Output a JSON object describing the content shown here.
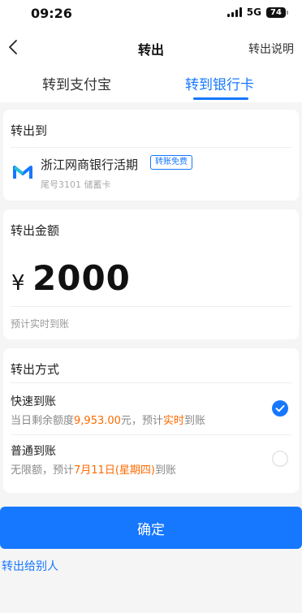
{
  "status": {
    "time": "09:26",
    "network": "5G",
    "battery": "74"
  },
  "nav": {
    "title": "转出",
    "help": "转出说明"
  },
  "tabs": [
    {
      "label": "转到支付宝",
      "active": false
    },
    {
      "label": "转到银行卡",
      "active": true
    }
  ],
  "destination": {
    "title": "转出到",
    "bank_name": "浙江网商银行活期",
    "badge": "转账免费",
    "sub": "尾号3101 储蓄卡"
  },
  "amount": {
    "title": "转出金额",
    "currency": "¥",
    "value": "2000",
    "hint": "预计实时到账"
  },
  "method": {
    "title": "转出方式",
    "options": [
      {
        "name": "快速到账",
        "desc_prefix": "当日剩余额度",
        "desc_highlight1": "9,953.00",
        "desc_mid": "元，预计",
        "desc_highlight2": "实时",
        "desc_suffix": "到账",
        "selected": true
      },
      {
        "name": "普通到账",
        "desc_prefix": "无限额，预计",
        "desc_highlight1": "7月11日(星期四)",
        "desc_suffix": "到账",
        "selected": false
      }
    ]
  },
  "confirm_label": "确定",
  "transfer_other_label": "转出给别人",
  "colors": {
    "accent": "#1677ff",
    "highlight": "#ff6a00",
    "background": "#f5f5f5"
  }
}
